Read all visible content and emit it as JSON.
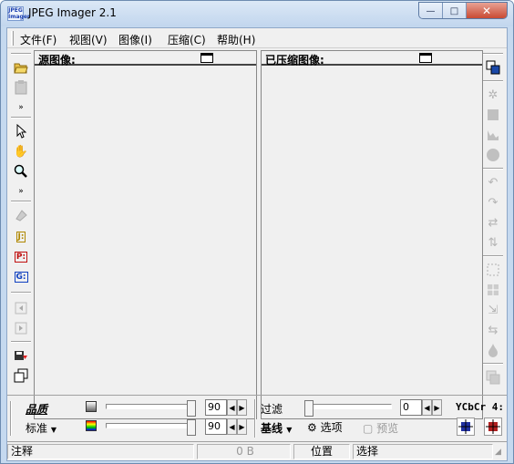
{
  "window": {
    "title": "JPEG Imager 2.1",
    "icon_text": "JPEG Imager",
    "minimize": "—",
    "maximize": "□",
    "close": "✕"
  },
  "menu": [
    "文件(F)",
    "视图(V)",
    "图像(I)",
    "压缩(C)",
    "帮助(H)"
  ],
  "panels": {
    "source_title": "源图像:",
    "compressed_title": "已压缩图像:"
  },
  "left_toolbar": [
    "open-folder-icon",
    "paste-icon",
    "pointer-icon",
    "hand-icon",
    "zoom-icon",
    "paint-icon",
    "jpeg-format-icon",
    "png-format-icon",
    "gif-format-icon",
    "prev-icon",
    "next-icon",
    "save-icon",
    "copy-window-icon"
  ],
  "right_toolbar": [
    "copy-icon",
    "bug-icon",
    "square-icon",
    "histogram-icon",
    "circle-icon",
    "rotate-left-icon",
    "rotate-right-icon",
    "flip-icon",
    "mirror-icon",
    "crop-icon",
    "grid-icon",
    "resize-icon",
    "swap-icon",
    "drop-icon",
    "layers-icon"
  ],
  "controls": {
    "quality_label": "品质",
    "preset_label": "标准",
    "quality_value": "90",
    "chroma_value": "90",
    "filter_label": "过滤",
    "filter_value": "0",
    "mode_label": "基线",
    "options_label": "选项",
    "preview_label": "预览",
    "ycbcr_label": "YCbCr 4:"
  },
  "status": {
    "note": "注释",
    "size": "0 B",
    "position": "位置",
    "selection": "选择"
  },
  "colors": {
    "title_bg": "#c5d9ef",
    "face": "#f0f0f0",
    "close_red": "#c7452d"
  }
}
